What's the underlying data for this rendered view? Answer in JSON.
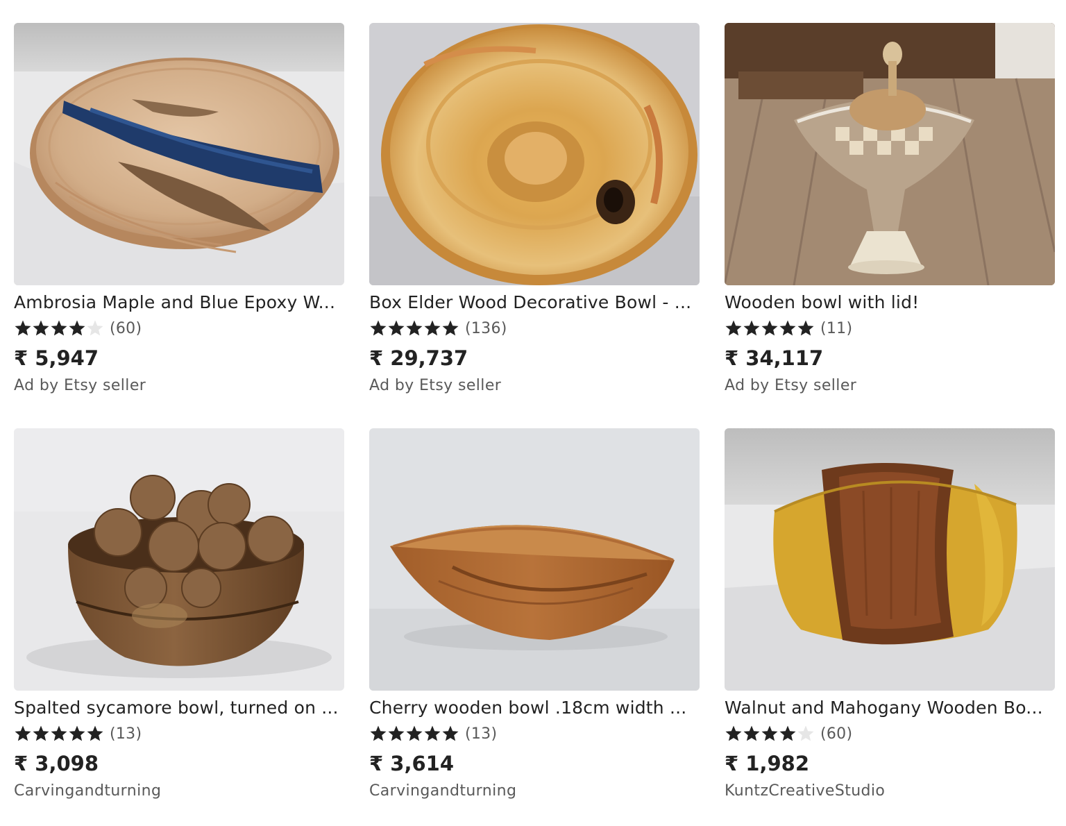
{
  "listings": [
    {
      "title": "Ambrosia Maple and Blue Epoxy W...",
      "rating": 4,
      "reviews": "(60)",
      "price": "₹ 5,947",
      "seller": "Ad by Etsy seller",
      "image": "epoxy-maple-tray-photo"
    },
    {
      "title": "Box Elder Wood Decorative Bowl - ...",
      "rating": 5,
      "reviews": "(136)",
      "price": "₹ 29,737",
      "seller": "Ad by Etsy seller",
      "image": "box-elder-bowl-photo"
    },
    {
      "title": "Wooden bowl with lid!",
      "rating": 5,
      "reviews": "(11)",
      "price": "₹ 34,117",
      "seller": "Ad by Etsy seller",
      "image": "lidded-pedestal-bowl-photo"
    },
    {
      "title": "Spalted sycamore bowl, turned on ...",
      "rating": 5,
      "reviews": "(13)",
      "price": "₹ 3,098",
      "seller": "Carvingandturning",
      "image": "walnut-filled-bowl-photo"
    },
    {
      "title": "Cherry wooden bowl .18cm width ...",
      "rating": 5,
      "reviews": "(13)",
      "price": "₹ 3,614",
      "seller": "Carvingandturning",
      "image": "cherry-bowl-photo"
    },
    {
      "title": "Walnut and Mahogany Wooden Bo...",
      "rating": 4,
      "reviews": "(60)",
      "price": "₹ 1,982",
      "seller": "KuntzCreativeStudio",
      "image": "walnut-mahogany-bowl-photo"
    }
  ]
}
